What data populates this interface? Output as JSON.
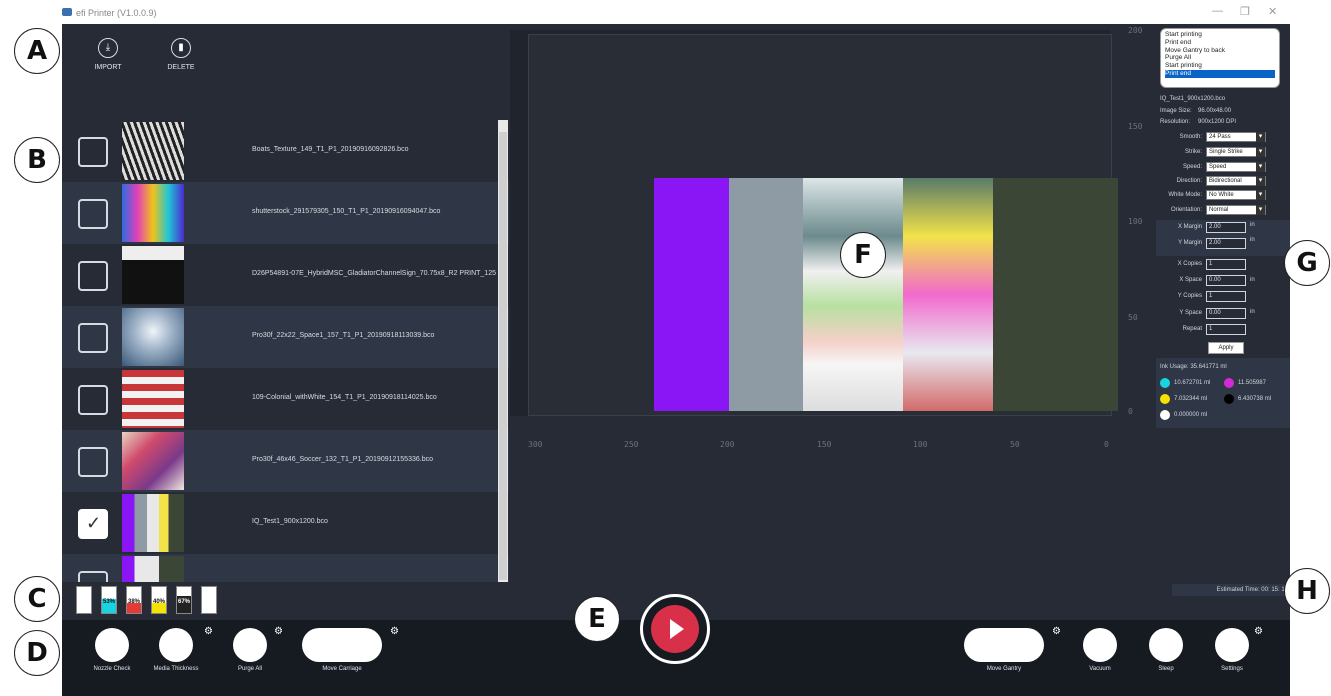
{
  "window": {
    "title": "efi Printer (V1.0.0.9)"
  },
  "toolbar": {
    "import_label": "IMPORT",
    "delete_label": "DELETE"
  },
  "files": [
    {
      "name": "Boats_Texture_149_T1_P1_20190916092826.bco",
      "checked": false
    },
    {
      "name": "shutterstock_291579305_150_T1_P1_20190916094047.bco",
      "checked": false
    },
    {
      "name": "D26P54891-07E_HybridMSC_GladiatorChannelSign_70.75x8_R2 PRINT_125",
      "checked": false
    },
    {
      "name": "Pro30f_22x22_Space1_157_T1_P1_20190918113039.bco",
      "checked": false
    },
    {
      "name": "109-Colonial_withWhite_154_T1_P1_20190918114025.bco",
      "checked": false
    },
    {
      "name": "Pro30f_46x46_Soccer_132_T1_P1_20190912155336.bco",
      "checked": false
    },
    {
      "name": "IQ_Test1_900x1200.bco",
      "checked": true
    }
  ],
  "ink_levels": [
    {
      "color": "#ffffff",
      "label": "",
      "level": 1.0
    },
    {
      "color": "#19d3e0",
      "label": "53%",
      "level": 0.53
    },
    {
      "color": "#e53935",
      "label": "38%",
      "level": 0.38
    },
    {
      "color": "#f5e400",
      "label": "40%",
      "level": 0.4
    },
    {
      "color": "#222222",
      "label": "67%",
      "level": 0.67
    },
    {
      "color": "#ffffff",
      "label": "",
      "level": 1.0
    }
  ],
  "footer": {
    "nozzle_check": "Nozzle Check",
    "media_thickness": "Media Thickness",
    "purge_all": "Purge All",
    "move_carriage": "Move Carriage",
    "move_gantry": "Move Gantry",
    "vacuum": "Vacuum",
    "sleep": "Sleep",
    "settings": "Settings"
  },
  "ruler": {
    "x_ticks": [
      "300",
      "250",
      "200",
      "150",
      "100",
      "50",
      "0"
    ],
    "y_ticks": [
      "200",
      "150",
      "100",
      "50",
      "0"
    ]
  },
  "log": [
    "Start printing",
    "Print end",
    "Move Gantry to back",
    "Purge All",
    "Start printing",
    "Print end"
  ],
  "image_info": {
    "filename": "IQ_Test1_900x1200.bco",
    "size_label": "Image Size:",
    "size_value": "96.00x48.00",
    "res_label": "Resolution:",
    "res_value": "900x1200 DPI"
  },
  "settings": {
    "smooth": {
      "label": "Smooth:",
      "value": "24 Pass"
    },
    "strike": {
      "label": "Strike:",
      "value": "Single Strike"
    },
    "speed": {
      "label": "Speed:",
      "value": "Speed"
    },
    "direction": {
      "label": "Direction:",
      "value": "Bidirectional"
    },
    "white_mode": {
      "label": "White Mode:",
      "value": "No White"
    },
    "orientation": {
      "label": "Orientation:",
      "value": "Normal"
    }
  },
  "margins": {
    "x_label": "X Margin",
    "x_value": "2.00",
    "y_label": "Y Margin",
    "y_value": "2.00",
    "unit": "in"
  },
  "copies": {
    "x_copies_label": "X Copies",
    "x_copies": "1",
    "x_space_label": "X Space",
    "x_space": "0.00",
    "y_copies_label": "Y Copies",
    "y_copies": "1",
    "y_space_label": "Y Space",
    "y_space": "0.00",
    "repeat_label": "Repeat",
    "repeat": "1",
    "unit": "in",
    "apply_label": "Apply"
  },
  "ink_usage": {
    "title": "Ink Usage: 35.641771 ml",
    "cyan": "10.672701 ml",
    "magenta": "11.505987",
    "yellow": "7.032344 ml",
    "black": "6.430738 ml",
    "white": "0.000000 ml"
  },
  "estimated_time": "Estimated Time: 00: 15: 18",
  "callouts": [
    "A",
    "B",
    "C",
    "D",
    "E",
    "F",
    "G",
    "H"
  ]
}
